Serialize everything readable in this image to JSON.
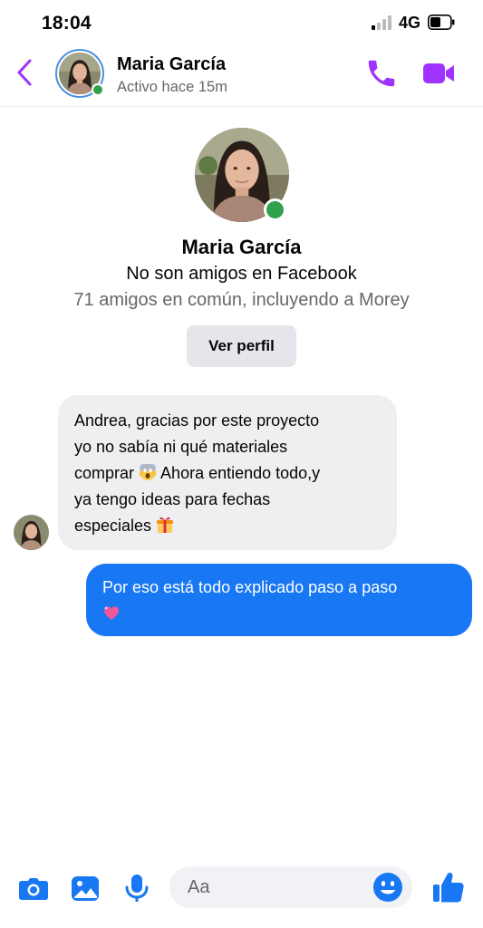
{
  "status_bar": {
    "time": "18:04",
    "network": "4G",
    "icons": [
      "signal-icon",
      "battery-icon"
    ]
  },
  "header": {
    "name": "Maria García",
    "status": "Activo hace 15m",
    "icons": [
      "back-icon",
      "phone-icon",
      "video-camera-icon"
    ]
  },
  "profile": {
    "name": "Maria García",
    "relationship": "No son amigos en Facebook",
    "mutual": "71 amigos en común, incluyendo a Morey",
    "button_label": "Ver perfil"
  },
  "messages": [
    {
      "direction": "incoming",
      "lines": [
        "Andrea, gracias por este proyecto",
        "yo no sabía ni qué materiales",
        "comprar",
        "Ahora entiendo todo,y",
        "ya tengo ideas para fechas",
        "especiales"
      ],
      "emojis": [
        "screaming-face-emoji",
        "gift-emoji"
      ]
    },
    {
      "direction": "outgoing",
      "lines": [
        "Por eso está todo explicado paso a paso"
      ],
      "emojis": [
        "sparkling-heart-emoji"
      ]
    }
  ],
  "composer": {
    "placeholder": "Aa",
    "icons": [
      "camera-icon",
      "gallery-icon",
      "microphone-icon",
      "emoji-icon",
      "thumbs-up-icon"
    ]
  },
  "colors": {
    "accent_purple": "#a033ff",
    "accent_blue": "#1877f2",
    "online_green": "#31a24c",
    "bubble_gray": "#efeff1"
  }
}
